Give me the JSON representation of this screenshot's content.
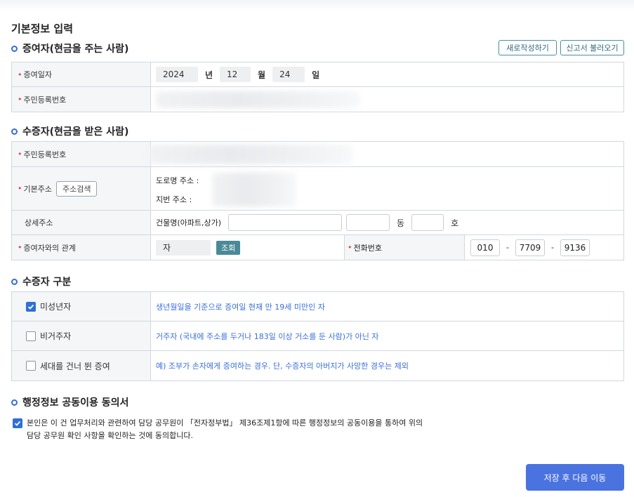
{
  "page_title": "기본정보 입력",
  "buttons": {
    "new": "새로작성하기",
    "load": "신고서 불러오기",
    "address_search": "주소검색",
    "query": "조회",
    "save": "저장 후 다음 이동"
  },
  "donor": {
    "section_title": "증여자(현금을 주는 사람)",
    "date_label": "증여일자",
    "year": "2024",
    "year_unit": "년",
    "month": "12",
    "month_unit": "월",
    "day": "24",
    "day_unit": "일",
    "rrn_label": "주민등록번호"
  },
  "donee": {
    "section_title": "수증자(현금을 받은 사람)",
    "rrn_label": "주민등록번호",
    "address_label": "기본주소",
    "road_address_label": "도로명 주소 :",
    "lot_address_label": "지번 주소 :",
    "detail_address_label": "상세주소",
    "building_label": "건물명(아파트,상가)",
    "dong_unit": "동",
    "ho_unit": "호",
    "relation_label": "증여자와의 관계",
    "relation_value": "자",
    "phone_label": "전화번호",
    "phone": [
      "010",
      "7709",
      "9136"
    ],
    "phone_sep": "-"
  },
  "donee_type": {
    "section_title": "수증자 구분",
    "items": [
      {
        "label": "미성년자",
        "checked": true,
        "desc": "생년월일을 기준으로 증여일 현재 만 19세 미만인 자"
      },
      {
        "label": "비거주자",
        "checked": false,
        "desc": "거주자 (국내에 주소를 두거나 183일 이상 거소를 둔 사람)가 아닌 자"
      },
      {
        "label": "세대를 건너 뛴 증여",
        "checked": false,
        "desc": "예) 조부가 손자에게 증여하는 경우. 단, 수증자의 아버지가 사망한 경우는 제외"
      }
    ]
  },
  "consent": {
    "section_title": "행정정보 공동이용 동의서",
    "checked": true,
    "line1": "본인은 이 건 업무처리와 관련하여 담당 공무원이 「전자정부법」 제36조제1항에 따른 행정정보의 공동이용을 통하여 위의",
    "line2": "담당 공무원 확인 사항을 확인하는 것에 동의합니다."
  },
  "colors": {
    "accent": "#2f6fd6",
    "required": "#e2463f",
    "save_button": "#4a73e0",
    "query_button": "#4a8a97",
    "desc_text": "#3a6fd8"
  }
}
